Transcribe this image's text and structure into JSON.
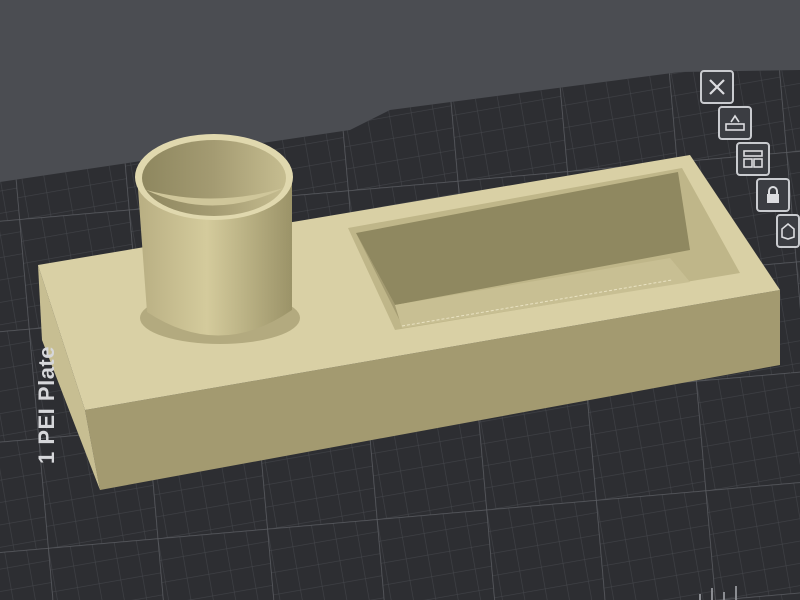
{
  "viewport": {
    "background_color": "#4b4d52",
    "plate_color": "#2d2e32",
    "grid_color": "#55575c",
    "model_color": "#d8cfa4"
  },
  "plate": {
    "label": "1 PEI Plate"
  },
  "plate_toolbar": {
    "buttons": [
      {
        "name": "close-icon"
      },
      {
        "name": "auto-orient-icon"
      },
      {
        "name": "arrange-icon"
      },
      {
        "name": "lock-icon"
      },
      {
        "name": "settings-icon"
      }
    ]
  }
}
